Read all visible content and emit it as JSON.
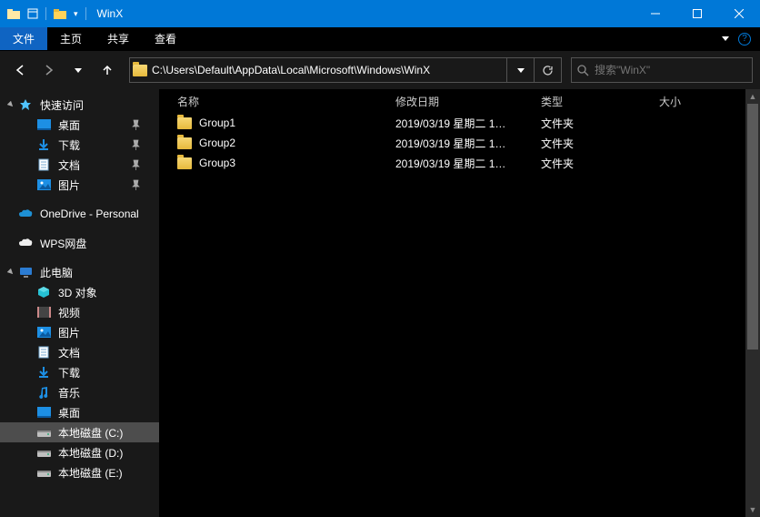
{
  "window": {
    "title": "WinX"
  },
  "ribbon": {
    "file_label": "文件",
    "tabs": [
      "主页",
      "共享",
      "查看"
    ]
  },
  "address": {
    "path": "C:\\Users\\Default\\AppData\\Local\\Microsoft\\Windows\\WinX"
  },
  "search": {
    "placeholder": "搜索\"WinX\""
  },
  "sidebar": {
    "quick": {
      "label": "快速访问",
      "items": [
        {
          "label": "桌面",
          "icon": "desktop",
          "pinned": true
        },
        {
          "label": "下载",
          "icon": "download",
          "pinned": true
        },
        {
          "label": "文档",
          "icon": "document",
          "pinned": true
        },
        {
          "label": "图片",
          "icon": "pictures",
          "pinned": true
        }
      ]
    },
    "onedrive": {
      "label": "OneDrive - Personal"
    },
    "wps": {
      "label": "WPS网盘"
    },
    "thispc": {
      "label": "此电脑",
      "items": [
        {
          "label": "3D 对象",
          "icon": "3d"
        },
        {
          "label": "视频",
          "icon": "video"
        },
        {
          "label": "图片",
          "icon": "pictures"
        },
        {
          "label": "文档",
          "icon": "document"
        },
        {
          "label": "下载",
          "icon": "download"
        },
        {
          "label": "音乐",
          "icon": "music"
        },
        {
          "label": "桌面",
          "icon": "desktop"
        },
        {
          "label": "本地磁盘 (C:)",
          "icon": "drive",
          "selected": true
        },
        {
          "label": "本地磁盘 (D:)",
          "icon": "drive"
        },
        {
          "label": "本地磁盘 (E:)",
          "icon": "drive"
        }
      ]
    }
  },
  "columns": {
    "name": "名称",
    "date": "修改日期",
    "type": "类型",
    "size": "大小"
  },
  "rows": [
    {
      "name": "Group1",
      "date": "2019/03/19 星期二 1…",
      "type": "文件夹",
      "size": ""
    },
    {
      "name": "Group2",
      "date": "2019/03/19 星期二 1…",
      "type": "文件夹",
      "size": ""
    },
    {
      "name": "Group3",
      "date": "2019/03/19 星期二 1…",
      "type": "文件夹",
      "size": ""
    }
  ]
}
